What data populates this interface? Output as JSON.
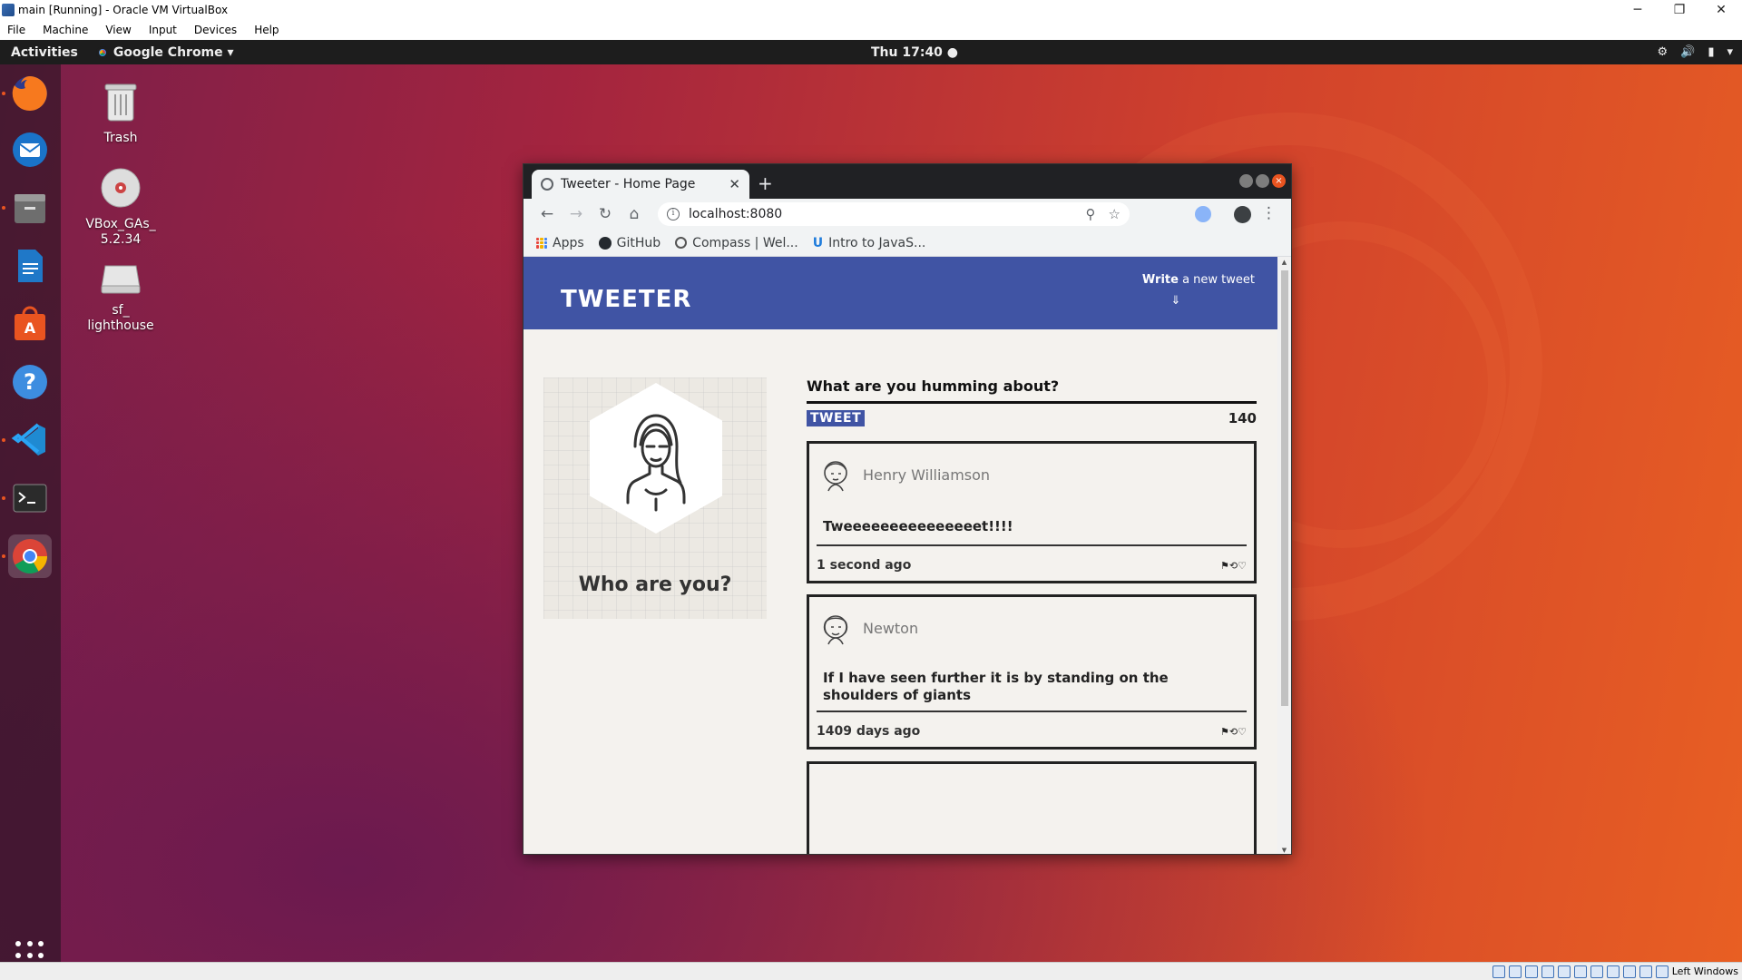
{
  "host": {
    "title": "main [Running] - Oracle VM VirtualBox",
    "window_controls": [
      "─",
      "❐",
      "✕"
    ],
    "menu": [
      "File",
      "Machine",
      "View",
      "Input",
      "Devices",
      "Help"
    ],
    "status_label": "Left Windows"
  },
  "gnome": {
    "activities": "Activities",
    "app_menu": "Google Chrome ▾",
    "clock": "Thu 17:40 ●",
    "tray": [
      "⚙",
      "🔊",
      "▮",
      "▾"
    ]
  },
  "dock": {
    "items": [
      "firefox-icon",
      "thunderbird-icon",
      "files-icon",
      "writer-icon",
      "software-icon",
      "help-icon",
      "vscode-icon",
      "terminal-icon",
      "chrome-icon"
    ]
  },
  "desktop_icons": [
    {
      "label": "Trash"
    },
    {
      "label": "VBox_GAs_\n5.2.34"
    },
    {
      "label": "sf_\nlighthouse"
    }
  ],
  "browser": {
    "tab_title": "Tweeter - Home Page",
    "tab_close": "✕",
    "new_tab": "+",
    "url": "localhost:8080",
    "bookmarks": [
      "Apps",
      "GitHub",
      "Compass | Wel...",
      "Intro to JavaS..."
    ]
  },
  "page": {
    "logo": "TWEETER",
    "compose_bold": "Write",
    "compose_rest": " a new tweet",
    "compose_arrow": "⇓",
    "profile_prompt": "Who are you?",
    "new_tweet_question": "What are you humming about?",
    "tweet_button": "TWEET",
    "char_count": "140",
    "accent_color": "#4054a4",
    "tweets": [
      {
        "name": "Henry Williamson",
        "text": "Tweeeeeeeeeeeeeeet!!!!",
        "time": "1 second ago",
        "actions": "⚑⟲♡"
      },
      {
        "name": "Newton",
        "text": "If I have seen further it is by standing on the shoulders of giants",
        "time": "1409 days ago",
        "actions": "⚑⟲♡"
      }
    ]
  }
}
